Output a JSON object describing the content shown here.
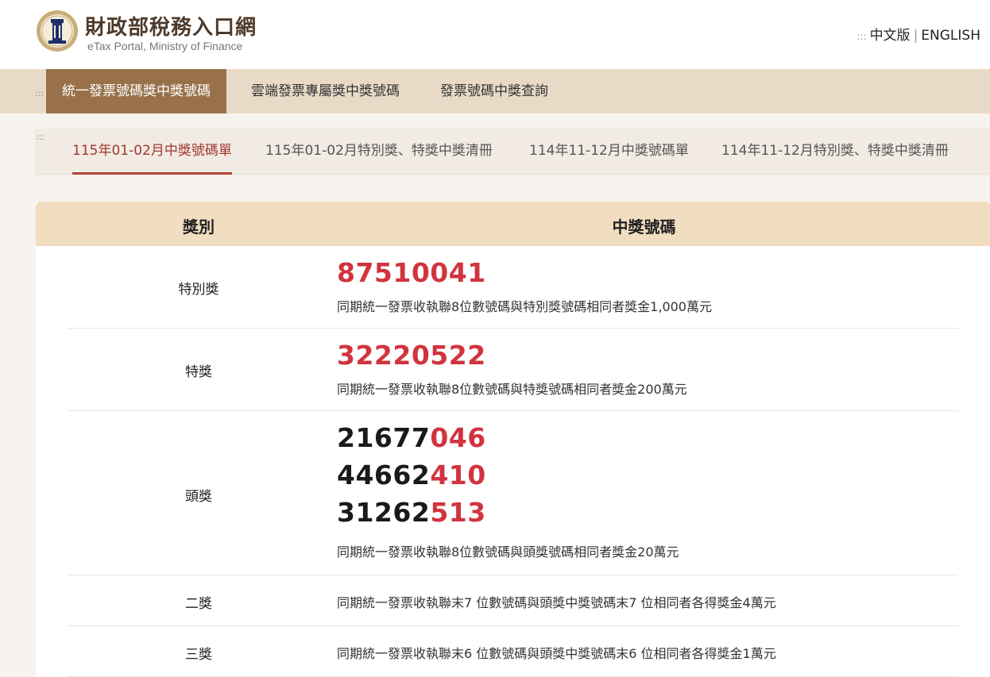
{
  "header": {
    "title": "財政部稅務入口網",
    "subtitle": "eTax Portal, Ministry of Finance",
    "lang_dots": ":::",
    "lang_zh": "中文版",
    "lang_sep": "|",
    "lang_en": "ENGLISH"
  },
  "main_nav": {
    "dots": ":::",
    "items": [
      "統一發票號碼獎中獎號碼",
      "雲端發票專屬獎中獎號碼",
      "發票號碼中獎查詢"
    ],
    "active_index": 0
  },
  "sub_nav": {
    "dots": ":::",
    "tabs": [
      "115年01-02月中獎號碼單",
      "115年01-02月特別獎、特獎中獎清冊",
      "114年11-12月中獎號碼單",
      "114年11-12月特別獎、特獎中獎清冊"
    ],
    "active_index": 0
  },
  "table": {
    "headers": [
      "獎別",
      "中獎號碼"
    ],
    "rows": [
      {
        "prize": "特別獎",
        "numbers": [
          {
            "lead": "",
            "tail": "87510041"
          }
        ],
        "desc": "同期統一發票收執聯8位數號碼與特別獎號碼相同者獎金1,000萬元"
      },
      {
        "prize": "特獎",
        "numbers": [
          {
            "lead": "",
            "tail": "32220522"
          }
        ],
        "desc": "同期統一發票收執聯8位數號碼與特獎號碼相同者獎金200萬元"
      },
      {
        "prize": "頭獎",
        "numbers": [
          {
            "lead": "21677",
            "tail": "046"
          },
          {
            "lead": "44662",
            "tail": "410"
          },
          {
            "lead": "31262",
            "tail": "513"
          }
        ],
        "desc": "同期統一發票收執聯8位數號碼與頭獎號碼相同者獎金20萬元"
      },
      {
        "prize": "二獎",
        "numbers": [],
        "desc": "同期統一發票收執聯末7 位數號碼與頭獎中獎號碼末7 位相同者各得獎金4萬元"
      },
      {
        "prize": "三獎",
        "numbers": [],
        "desc": "同期統一發票收執聯末6 位數號碼與頭獎中獎號碼末6 位相同者各得獎金1萬元"
      }
    ]
  },
  "colors": {
    "brand_brown": "#98714a",
    "nav_bg": "#e8dac7",
    "table_header_bg": "#f1ddbf",
    "winning_red": "#d1343e",
    "active_tab_red": "#a0382e"
  }
}
